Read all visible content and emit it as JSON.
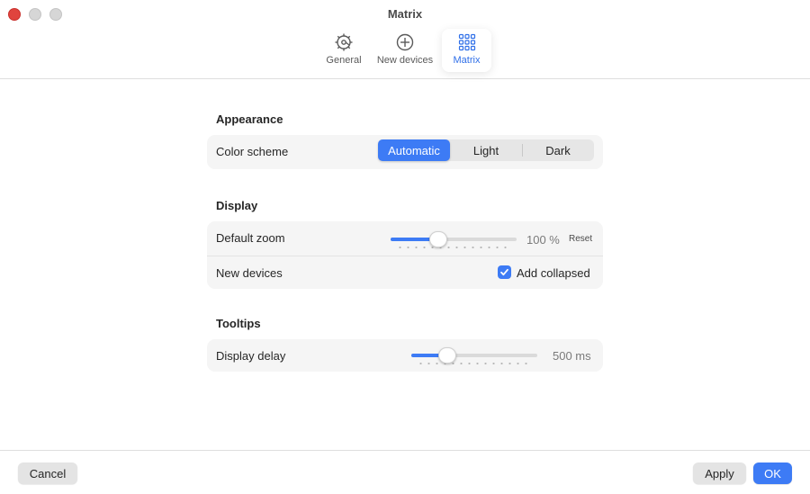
{
  "window": {
    "title": "Matrix"
  },
  "toolbar": {
    "tabs": [
      {
        "label": "General",
        "icon": "gear-icon"
      },
      {
        "label": "New devices",
        "icon": "plus-circle-icon"
      },
      {
        "label": "Matrix",
        "icon": "grid-icon",
        "selected": true
      }
    ]
  },
  "appearance": {
    "title": "Appearance",
    "color_scheme": {
      "label": "Color scheme",
      "options": [
        "Automatic",
        "Light",
        "Dark"
      ],
      "selected": "Automatic"
    }
  },
  "display": {
    "title": "Display",
    "default_zoom": {
      "label": "Default zoom",
      "value_text": "100 %",
      "reset_label": "Reset",
      "level": 0.36
    },
    "new_devices": {
      "label": "New devices",
      "checkbox_label": "Add collapsed",
      "checked": true
    }
  },
  "tooltips": {
    "title": "Tooltips",
    "display_delay": {
      "label": "Display delay",
      "value_text": "500 ms",
      "level": 0.25
    }
  },
  "footer": {
    "cancel_label": "Cancel",
    "apply_label": "Apply",
    "ok_label": "OK"
  },
  "colors": {
    "accent": "#3d7bf5",
    "close_button": "#e0443e"
  }
}
